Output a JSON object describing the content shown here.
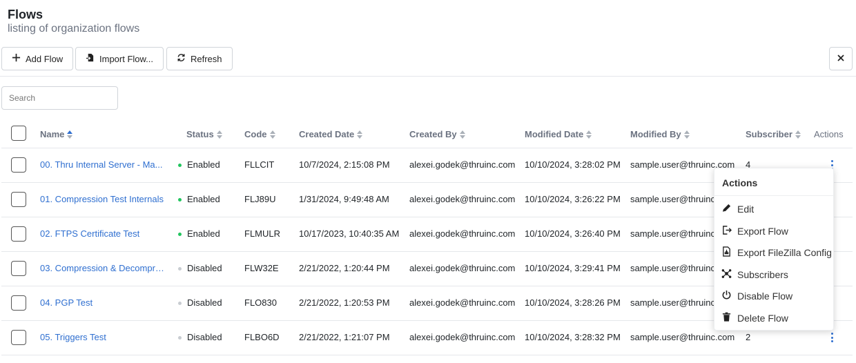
{
  "header": {
    "title": "Flows",
    "subtitle": "listing of organization flows"
  },
  "toolbar": {
    "add_label": "Add Flow",
    "import_label": "Import Flow...",
    "refresh_label": "Refresh"
  },
  "search": {
    "placeholder": "Search",
    "value": ""
  },
  "table": {
    "columns": {
      "name": "Name",
      "status": "Status",
      "code": "Code",
      "created_date": "Created Date",
      "created_by": "Created By",
      "modified_date": "Modified Date",
      "modified_by": "Modified By",
      "subscriber": "Subscriber",
      "actions": "Actions"
    },
    "sorted_column": "name",
    "rows": [
      {
        "name": "00. Thru Internal Server - Ma...",
        "status": "Enabled",
        "code": "FLLCIT",
        "created_date": "10/7/2024, 2:15:08 PM",
        "created_by": "alexei.godek@thruinc.com",
        "modified_date": "10/10/2024, 3:28:02 PM",
        "modified_by": "sample.user@thruinc.com",
        "subscriber": "4"
      },
      {
        "name": "01. Compression Test Internals",
        "status": "Enabled",
        "code": "FLJ89U",
        "created_date": "1/31/2024, 9:49:48 AM",
        "created_by": "alexei.godek@thruinc.com",
        "modified_date": "10/10/2024, 3:26:22 PM",
        "modified_by": "sample.user@thruinc.com",
        "subscriber": ""
      },
      {
        "name": "02. FTPS Certificate Test",
        "status": "Enabled",
        "code": "FLMULR",
        "created_date": "10/17/2023, 10:40:35 AM",
        "created_by": "alexei.godek@thruinc.com",
        "modified_date": "10/10/2024, 3:26:40 PM",
        "modified_by": "sample.user@thruinc.com",
        "subscriber": ""
      },
      {
        "name": "03. Compression & Decompre...",
        "status": "Disabled",
        "code": "FLW32E",
        "created_date": "2/21/2022, 1:20:44 PM",
        "created_by": "alexei.godek@thruinc.com",
        "modified_date": "10/10/2024, 3:29:41 PM",
        "modified_by": "sample.user@thruinc.com",
        "subscriber": ""
      },
      {
        "name": "04. PGP Test",
        "status": "Disabled",
        "code": "FLO830",
        "created_date": "2/21/2022, 1:20:53 PM",
        "created_by": "alexei.godek@thruinc.com",
        "modified_date": "10/10/2024, 3:28:26 PM",
        "modified_by": "sample.user@thruinc.com",
        "subscriber": ""
      },
      {
        "name": "05. Triggers Test",
        "status": "Disabled",
        "code": "FLBO6D",
        "created_date": "2/21/2022, 1:21:07 PM",
        "created_by": "alexei.godek@thruinc.com",
        "modified_date": "10/10/2024, 3:28:32 PM",
        "modified_by": "sample.user@thruinc.com",
        "subscriber": "2"
      }
    ]
  },
  "actions_menu": {
    "title": "Actions",
    "items": [
      {
        "label": "Edit",
        "icon": "pencil-icon"
      },
      {
        "label": "Export Flow",
        "icon": "export-icon"
      },
      {
        "label": "Export FileZilla Config",
        "icon": "file-export-icon"
      },
      {
        "label": "Subscribers",
        "icon": "subscribers-icon"
      },
      {
        "label": "Disable Flow",
        "icon": "power-icon"
      },
      {
        "label": "Delete Flow",
        "icon": "trash-icon"
      }
    ]
  },
  "colors": {
    "link": "#2f6fd0",
    "enabled": "#22c55e",
    "disabled": "#c8ccd1"
  }
}
